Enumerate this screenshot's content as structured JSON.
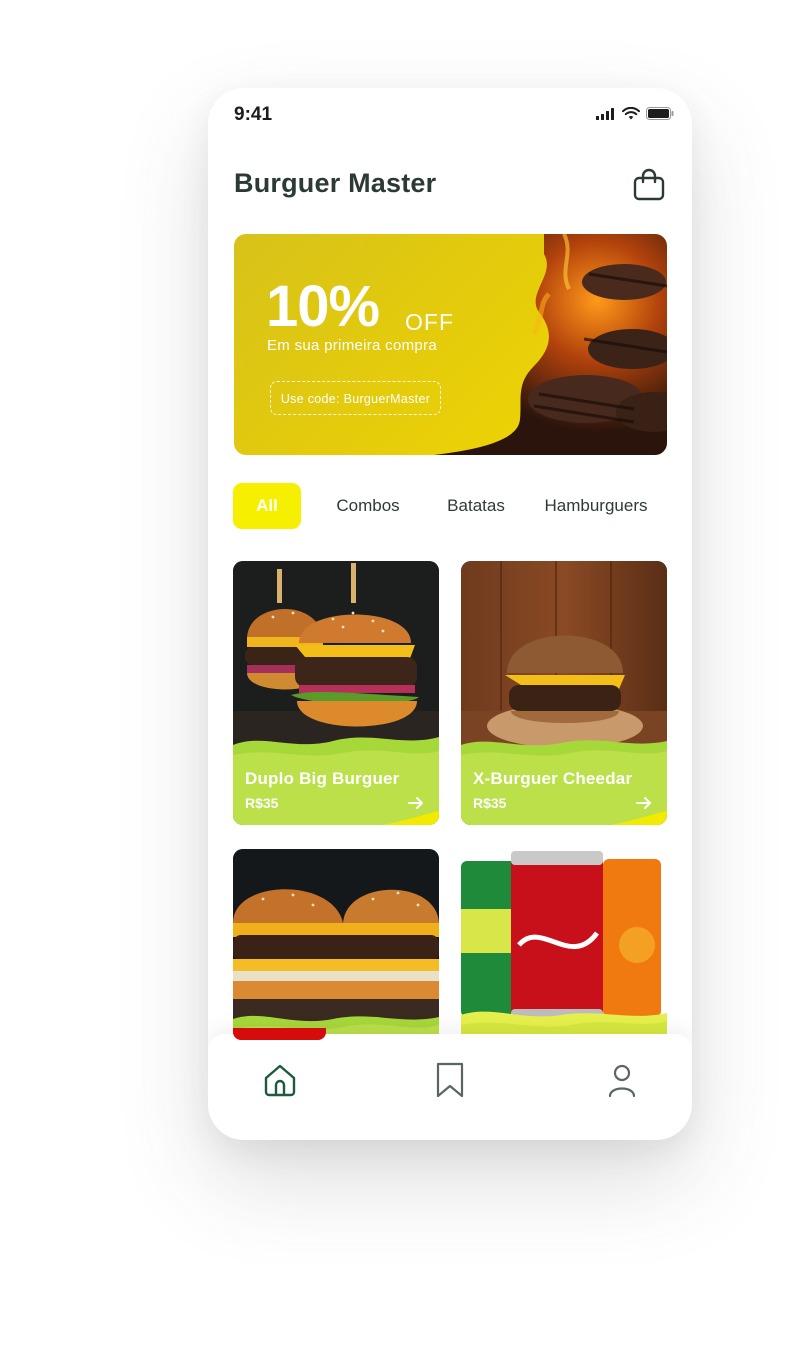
{
  "status_bar": {
    "time": "9:41",
    "icons": [
      "signal-icon",
      "wifi-icon",
      "battery-icon"
    ]
  },
  "header": {
    "title": "Burguer Master",
    "cart_icon": "shopping-bag-icon"
  },
  "promo": {
    "percent": "10%",
    "off_label": "OFF",
    "subtitle": "Em sua primeira compra",
    "code_label": "Use code: BurguerMaster"
  },
  "categories": [
    {
      "label": "All",
      "active": true
    },
    {
      "label": "Combos",
      "active": false
    },
    {
      "label": "Batatas",
      "active": false
    },
    {
      "label": "Hamburguers",
      "active": false
    }
  ],
  "products": [
    {
      "name": "Duplo Big Burguer",
      "price": "R$35"
    },
    {
      "name": "X-Burguer Cheedar",
      "price": "R$35"
    },
    {
      "name": "",
      "price": ""
    },
    {
      "name": "",
      "price": ""
    }
  ],
  "bottom_nav": [
    {
      "icon": "home-icon",
      "active": true
    },
    {
      "icon": "bookmark-icon",
      "active": false
    },
    {
      "icon": "user-icon",
      "active": false
    }
  ],
  "colors": {
    "accent_yellow": "#f7ef00",
    "promo_gold": "#e4cb0c",
    "card_green": "#b5dc3c",
    "nav_active": "#d60b0b",
    "title_text": "#2c3a35"
  }
}
